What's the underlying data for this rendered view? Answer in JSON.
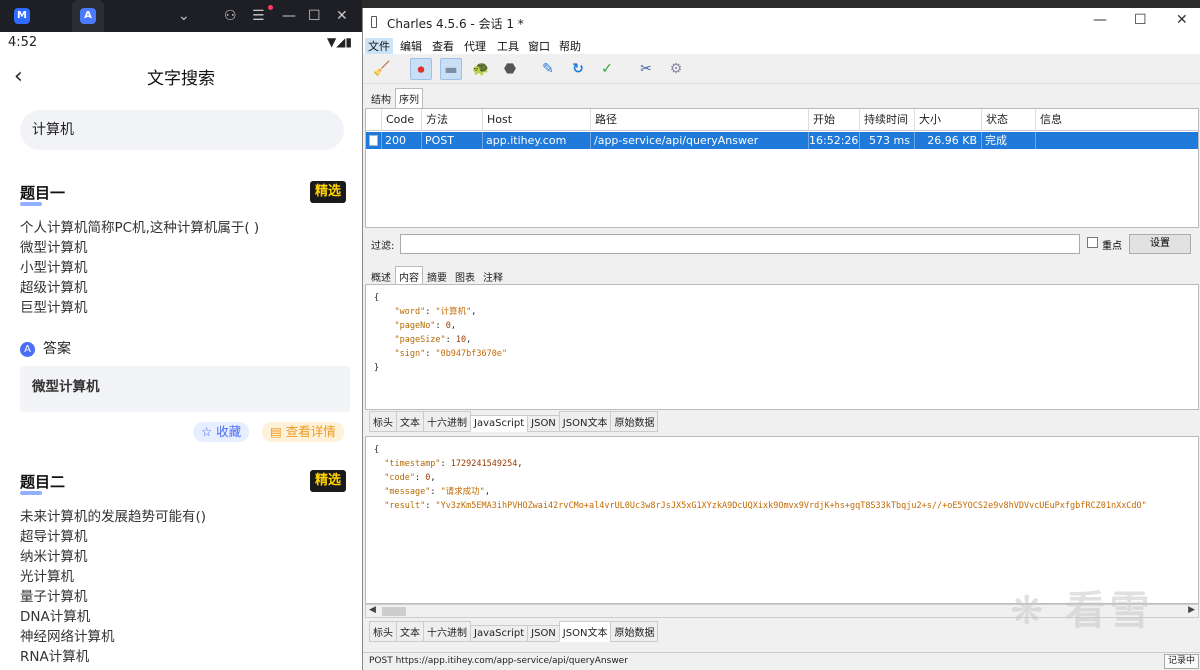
{
  "phone": {
    "emulator_bar": {
      "app_icon_text": "M",
      "tab_icon_text": "A",
      "chevron": "⌄",
      "user": "⚇",
      "menu": "☰",
      "minimize": "—",
      "maximize": "☐",
      "close": "✕"
    },
    "status": {
      "time": "4:52",
      "icons": "▼◢▮"
    },
    "nav": {
      "back": "‹",
      "title": "文字搜索"
    },
    "search": {
      "value": "计算机"
    },
    "q1": {
      "title": "题目一",
      "badge": "精选",
      "lines": [
        "个人计算机简称PC机,这种计算机属于( )",
        "微型计算机",
        "小型计算机",
        "超级计算机",
        "巨型计算机"
      ]
    },
    "answer": {
      "label": "答案",
      "icon": "A",
      "value": "微型计算机"
    },
    "actions": {
      "favorite": "☆ 收藏",
      "details": "▤ 查看详情"
    },
    "q2": {
      "title": "题目二",
      "badge": "精选",
      "lines": [
        "未来计算机的发展趋势可能有()",
        "超导计算机",
        "纳米计算机",
        "光计算机",
        "量子计算机",
        "DNA计算机",
        "神经网络计算机",
        "RNA计算机"
      ]
    }
  },
  "charles": {
    "title": "Charles 4.5.6 - 会话 1 *",
    "window_controls": {
      "minimize": "—",
      "maximize": "☐",
      "close": "✕"
    },
    "menu": [
      "文件",
      "编辑",
      "查看",
      "代理",
      "工具",
      "窗口",
      "帮助"
    ],
    "toolbar_icons": [
      {
        "name": "broom-icon",
        "glyph": "🧹"
      },
      {
        "name": "record-icon",
        "glyph": "⏺"
      },
      {
        "name": "throttle-icon",
        "glyph": "▬"
      },
      {
        "name": "turtle-icon",
        "glyph": "🐢"
      },
      {
        "name": "stop-icon",
        "glyph": "⬣"
      },
      {
        "name": "pen-icon",
        "glyph": "✎"
      },
      {
        "name": "refresh-icon",
        "glyph": "↻"
      },
      {
        "name": "check-icon",
        "glyph": "✓"
      },
      {
        "name": "tools-icon",
        "glyph": "✂"
      },
      {
        "name": "gear-icon",
        "glyph": "⚙"
      }
    ],
    "view_tabs": [
      "结构",
      "序列"
    ],
    "columns": [
      "Code",
      "方法",
      "Host",
      "路径",
      "开始",
      "持续时间",
      "大小",
      "状态",
      "信息"
    ],
    "rows": [
      {
        "code": "200",
        "method": "POST",
        "host": "app.itihey.com",
        "path": "/app-service/api/queryAnswer",
        "start": "16:52:26",
        "duration": "573 ms",
        "size": "26.96 KB",
        "status": "完成",
        "info": ""
      }
    ],
    "filter": {
      "label": "过滤:",
      "value": "",
      "focus_label": "重点",
      "settings": "设置"
    },
    "detail_tabs": [
      "概述",
      "内容",
      "摘要",
      "图表",
      "注释"
    ],
    "request_json": {
      "open": "{",
      "k1": "\"word\"",
      "v1": "\"计算机\"",
      "k2": "\"pageNo\"",
      "v2": "0",
      "k3": "\"pageSize\"",
      "v3": "10",
      "k4": "\"sign\"",
      "v4": "\"0b947bf3670e\"",
      "close": "}"
    },
    "request_tabs": [
      "标头",
      "文本",
      "十六进制",
      "JavaScript",
      "JSON",
      "JSON文本",
      "原始数据"
    ],
    "response_json": {
      "open": "{",
      "k1": "\"timestamp\"",
      "v1": "1729241549254",
      "k2": "\"code\"",
      "v2": "0",
      "k3": "\"message\"",
      "v3": "\"请求成功\"",
      "k4": "\"result\"",
      "v4": "\"Yv3zKm5EMA3ihPVHOZwai42rvCMo+al4vrUL0Uc3w8rJsJX5xG1XYzkA9DcUQXixk9Omvx9VrdjK+hs+gqT8S33kTbqju2+s//+oE5YOCS2e9v8hVDVvcUEuPxfgbfRCZ01nXxCdO\""
    },
    "response_tabs": [
      "标头",
      "文本",
      "十六进制",
      "JavaScript",
      "JSON",
      "JSON文本",
      "原始数据"
    ],
    "status_text": "POST https://app.itihey.com/app-service/api/queryAnswer",
    "recording": "记录中"
  },
  "watermark": "❋ 看雪"
}
